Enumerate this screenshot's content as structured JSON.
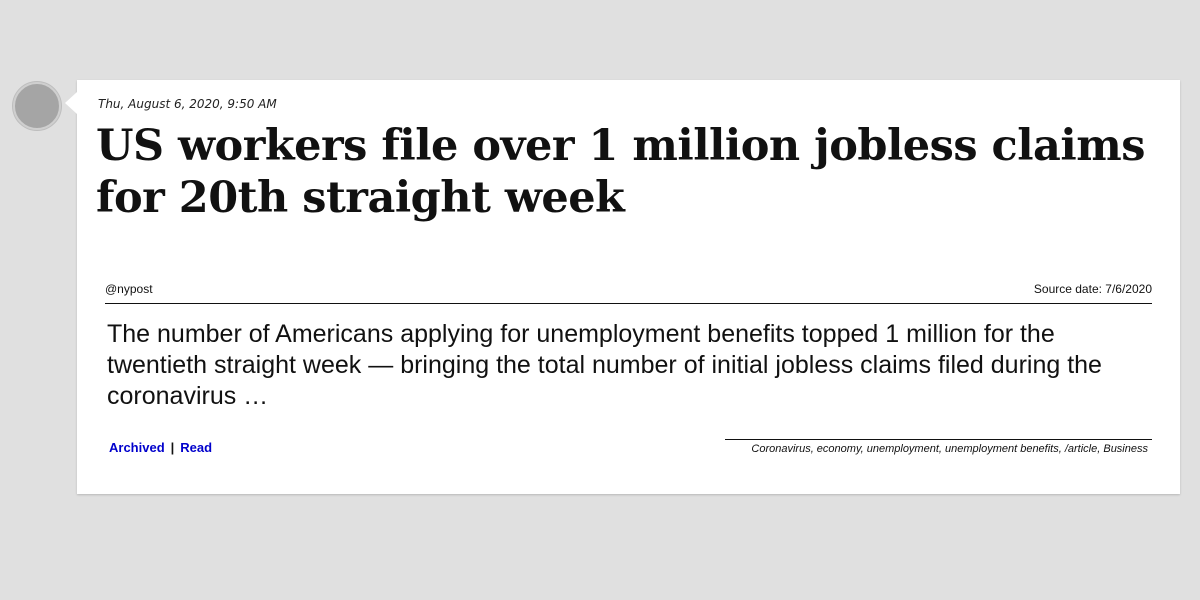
{
  "post": {
    "timestamp": "Thu, August 6, 2020, 9:50 AM",
    "headline": "US workers file over 1 million jobless claims for 20th straight week",
    "source_handle": "@nypost",
    "source_date": "Source date: 7/6/2020",
    "summary": "The number of Americans applying for unemployment benefits topped 1 million for the twentieth straight week — bringing the total number of initial jobless claims filed during the coronavirus …",
    "links": {
      "archived": "Archived",
      "separator": "|",
      "read": "Read"
    },
    "tags": "Coronavirus, economy, unemployment, unemployment benefits, /article, Business"
  },
  "colors": {
    "background": "#e0e0e0",
    "card": "#ffffff",
    "link": "#0000cc",
    "avatar": "#a5a5a5"
  }
}
